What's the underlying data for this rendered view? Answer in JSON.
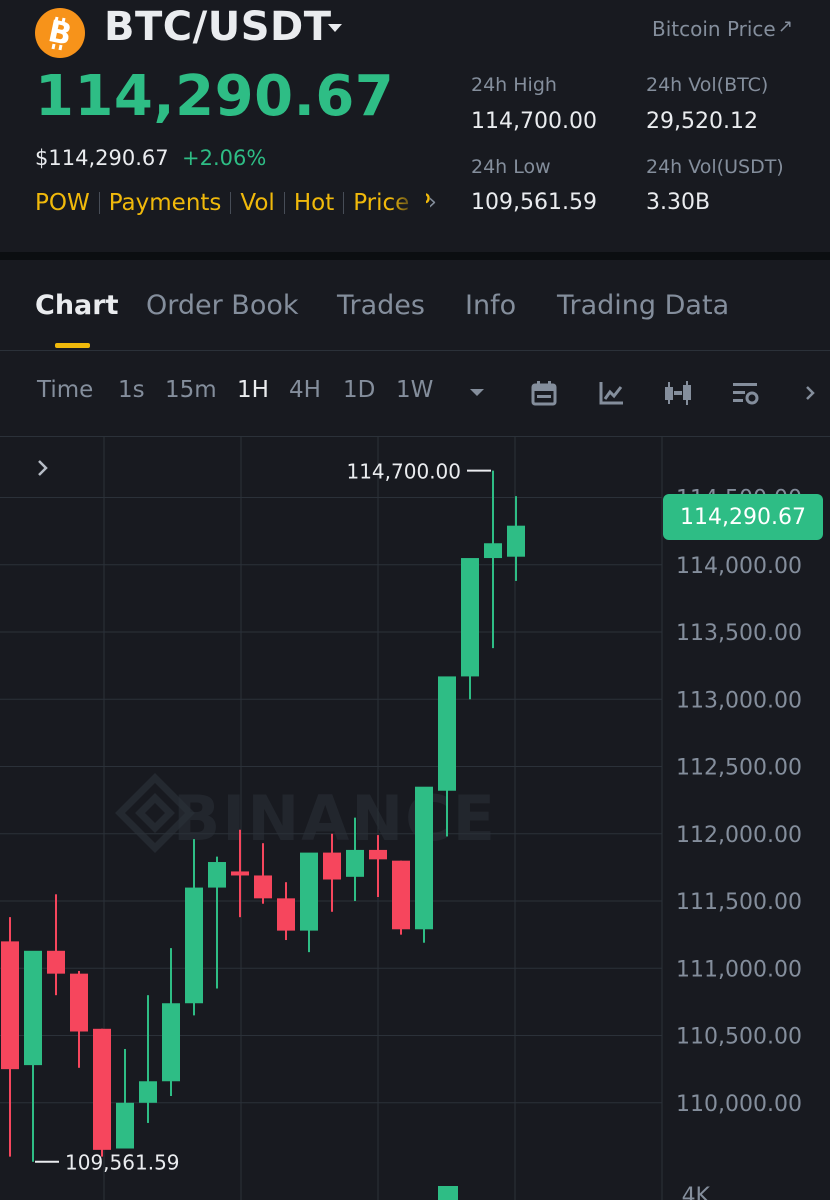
{
  "header": {
    "pair": "BTC/USDT",
    "price_link": "Bitcoin Price",
    "price_link_icon": "↗",
    "last_price": "114,290.67",
    "usd_price": "$114,290.67",
    "change_pct": "+2.06%",
    "tags": [
      "POW",
      "Payments",
      "Vol",
      "Hot",
      "Price P"
    ],
    "tags_more_icon": "›"
  },
  "stats": {
    "high_label": "24h High",
    "high_value": "114,700.00",
    "vol_btc_label": "24h Vol(BTC)",
    "vol_btc_value": "29,520.12",
    "low_label": "24h Low",
    "low_value": "109,561.59",
    "vol_usdt_label": "24h Vol(USDT)",
    "vol_usdt_value": "3.30B"
  },
  "tabs": [
    "Chart",
    "Order Book",
    "Trades",
    "Info",
    "Trading Data"
  ],
  "active_tab": "Chart",
  "intervals": [
    "Time",
    "1s",
    "15m",
    "1H",
    "4H",
    "1D",
    "1W"
  ],
  "active_interval": "1H",
  "toolbar_icons": [
    "interval-dropdown-icon",
    "calendar-icon",
    "indicator-icon",
    "candlestick-icon",
    "chart-settings-icon",
    "more-icon"
  ],
  "chart_data": {
    "type": "candlestick",
    "interval": "1H",
    "watermark": "BINANCE",
    "last_price_label": "114,290.67",
    "high_marker": "114,700.00",
    "low_marker": "109,561.59",
    "y_ticks": [
      "114,500.00",
      "114,000.00",
      "113,500.00",
      "113,000.00",
      "112,500.00",
      "112,000.00",
      "111,500.00",
      "111,000.00",
      "110,500.00",
      "110,000.00"
    ],
    "y_tick_values": [
      114500,
      114000,
      113500,
      113000,
      112500,
      112000,
      111500,
      111000,
      110500,
      110000
    ],
    "ylim": [
      109411,
      114950
    ],
    "volume_label": "4K",
    "colors": {
      "up": "#2ebd85",
      "down": "#f6465d",
      "grid": "#2b3139",
      "axis_text": "#848e9c"
    },
    "candles": [
      {
        "o": 111200,
        "h": 111380,
        "l": 109600,
        "c": 110250
      },
      {
        "o": 110280,
        "h": 111080,
        "l": 109561.59,
        "c": 111130
      },
      {
        "o": 111130,
        "h": 111550,
        "l": 110800,
        "c": 110960
      },
      {
        "o": 110960,
        "h": 110980,
        "l": 110260,
        "c": 110530
      },
      {
        "o": 110550,
        "h": 110550,
        "l": 109600,
        "c": 109650
      },
      {
        "o": 109660,
        "h": 110400,
        "l": 109700,
        "c": 110000
      },
      {
        "o": 110000,
        "h": 110800,
        "l": 109850,
        "c": 110160
      },
      {
        "o": 110160,
        "h": 111150,
        "l": 110050,
        "c": 110740
      },
      {
        "o": 110740,
        "h": 111960,
        "l": 110650,
        "c": 111600
      },
      {
        "o": 111600,
        "h": 111830,
        "l": 110850,
        "c": 111790
      },
      {
        "o": 111720,
        "h": 112030,
        "l": 111380,
        "c": 111690
      },
      {
        "o": 111690,
        "h": 111930,
        "l": 111480,
        "c": 111520
      },
      {
        "o": 111520,
        "h": 111640,
        "l": 111210,
        "c": 111280
      },
      {
        "o": 111280,
        "h": 111830,
        "l": 111120,
        "c": 111860
      },
      {
        "o": 111860,
        "h": 112000,
        "l": 111420,
        "c": 111660
      },
      {
        "o": 111680,
        "h": 112120,
        "l": 111500,
        "c": 111880
      },
      {
        "o": 111880,
        "h": 111990,
        "l": 111530,
        "c": 111810
      },
      {
        "o": 111800,
        "h": 111800,
        "l": 111250,
        "c": 111290
      },
      {
        "o": 111290,
        "h": 112000,
        "l": 111190,
        "c": 112350
      },
      {
        "o": 112320,
        "h": 112850,
        "l": 111980,
        "c": 113170
      },
      {
        "o": 113170,
        "h": 113700,
        "l": 113000,
        "c": 114050
      },
      {
        "o": 114050,
        "h": 114700,
        "l": 113380,
        "c": 114160
      },
      {
        "o": 114060,
        "h": 114510,
        "l": 113880,
        "c": 114290.67
      }
    ]
  }
}
